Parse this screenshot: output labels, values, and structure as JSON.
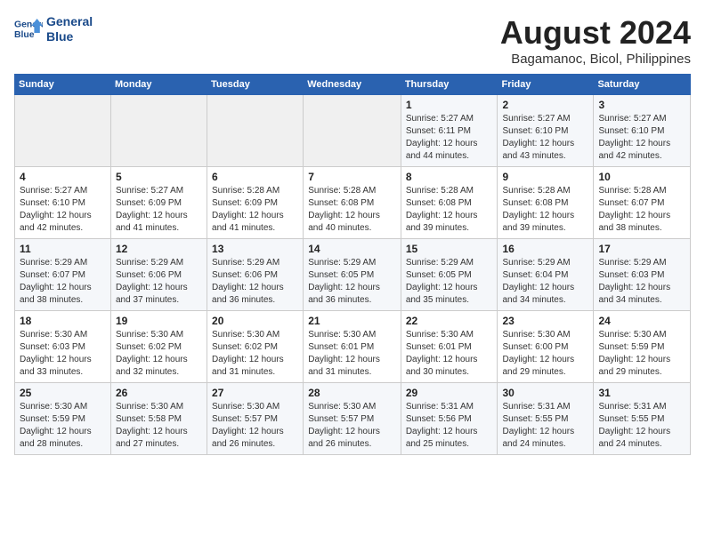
{
  "header": {
    "logo_line1": "General",
    "logo_line2": "Blue",
    "month_year": "August 2024",
    "location": "Bagamanoc, Bicol, Philippines"
  },
  "weekdays": [
    "Sunday",
    "Monday",
    "Tuesday",
    "Wednesday",
    "Thursday",
    "Friday",
    "Saturday"
  ],
  "weeks": [
    [
      {
        "day": "",
        "info": ""
      },
      {
        "day": "",
        "info": ""
      },
      {
        "day": "",
        "info": ""
      },
      {
        "day": "",
        "info": ""
      },
      {
        "day": "1",
        "info": "Sunrise: 5:27 AM\nSunset: 6:11 PM\nDaylight: 12 hours\nand 44 minutes."
      },
      {
        "day": "2",
        "info": "Sunrise: 5:27 AM\nSunset: 6:10 PM\nDaylight: 12 hours\nand 43 minutes."
      },
      {
        "day": "3",
        "info": "Sunrise: 5:27 AM\nSunset: 6:10 PM\nDaylight: 12 hours\nand 42 minutes."
      }
    ],
    [
      {
        "day": "4",
        "info": "Sunrise: 5:27 AM\nSunset: 6:10 PM\nDaylight: 12 hours\nand 42 minutes."
      },
      {
        "day": "5",
        "info": "Sunrise: 5:27 AM\nSunset: 6:09 PM\nDaylight: 12 hours\nand 41 minutes."
      },
      {
        "day": "6",
        "info": "Sunrise: 5:28 AM\nSunset: 6:09 PM\nDaylight: 12 hours\nand 41 minutes."
      },
      {
        "day": "7",
        "info": "Sunrise: 5:28 AM\nSunset: 6:08 PM\nDaylight: 12 hours\nand 40 minutes."
      },
      {
        "day": "8",
        "info": "Sunrise: 5:28 AM\nSunset: 6:08 PM\nDaylight: 12 hours\nand 39 minutes."
      },
      {
        "day": "9",
        "info": "Sunrise: 5:28 AM\nSunset: 6:08 PM\nDaylight: 12 hours\nand 39 minutes."
      },
      {
        "day": "10",
        "info": "Sunrise: 5:28 AM\nSunset: 6:07 PM\nDaylight: 12 hours\nand 38 minutes."
      }
    ],
    [
      {
        "day": "11",
        "info": "Sunrise: 5:29 AM\nSunset: 6:07 PM\nDaylight: 12 hours\nand 38 minutes."
      },
      {
        "day": "12",
        "info": "Sunrise: 5:29 AM\nSunset: 6:06 PM\nDaylight: 12 hours\nand 37 minutes."
      },
      {
        "day": "13",
        "info": "Sunrise: 5:29 AM\nSunset: 6:06 PM\nDaylight: 12 hours\nand 36 minutes."
      },
      {
        "day": "14",
        "info": "Sunrise: 5:29 AM\nSunset: 6:05 PM\nDaylight: 12 hours\nand 36 minutes."
      },
      {
        "day": "15",
        "info": "Sunrise: 5:29 AM\nSunset: 6:05 PM\nDaylight: 12 hours\nand 35 minutes."
      },
      {
        "day": "16",
        "info": "Sunrise: 5:29 AM\nSunset: 6:04 PM\nDaylight: 12 hours\nand 34 minutes."
      },
      {
        "day": "17",
        "info": "Sunrise: 5:29 AM\nSunset: 6:03 PM\nDaylight: 12 hours\nand 34 minutes."
      }
    ],
    [
      {
        "day": "18",
        "info": "Sunrise: 5:30 AM\nSunset: 6:03 PM\nDaylight: 12 hours\nand 33 minutes."
      },
      {
        "day": "19",
        "info": "Sunrise: 5:30 AM\nSunset: 6:02 PM\nDaylight: 12 hours\nand 32 minutes."
      },
      {
        "day": "20",
        "info": "Sunrise: 5:30 AM\nSunset: 6:02 PM\nDaylight: 12 hours\nand 31 minutes."
      },
      {
        "day": "21",
        "info": "Sunrise: 5:30 AM\nSunset: 6:01 PM\nDaylight: 12 hours\nand 31 minutes."
      },
      {
        "day": "22",
        "info": "Sunrise: 5:30 AM\nSunset: 6:01 PM\nDaylight: 12 hours\nand 30 minutes."
      },
      {
        "day": "23",
        "info": "Sunrise: 5:30 AM\nSunset: 6:00 PM\nDaylight: 12 hours\nand 29 minutes."
      },
      {
        "day": "24",
        "info": "Sunrise: 5:30 AM\nSunset: 5:59 PM\nDaylight: 12 hours\nand 29 minutes."
      }
    ],
    [
      {
        "day": "25",
        "info": "Sunrise: 5:30 AM\nSunset: 5:59 PM\nDaylight: 12 hours\nand 28 minutes."
      },
      {
        "day": "26",
        "info": "Sunrise: 5:30 AM\nSunset: 5:58 PM\nDaylight: 12 hours\nand 27 minutes."
      },
      {
        "day": "27",
        "info": "Sunrise: 5:30 AM\nSunset: 5:57 PM\nDaylight: 12 hours\nand 26 minutes."
      },
      {
        "day": "28",
        "info": "Sunrise: 5:30 AM\nSunset: 5:57 PM\nDaylight: 12 hours\nand 26 minutes."
      },
      {
        "day": "29",
        "info": "Sunrise: 5:31 AM\nSunset: 5:56 PM\nDaylight: 12 hours\nand 25 minutes."
      },
      {
        "day": "30",
        "info": "Sunrise: 5:31 AM\nSunset: 5:55 PM\nDaylight: 12 hours\nand 24 minutes."
      },
      {
        "day": "31",
        "info": "Sunrise: 5:31 AM\nSunset: 5:55 PM\nDaylight: 12 hours\nand 24 minutes."
      }
    ]
  ]
}
